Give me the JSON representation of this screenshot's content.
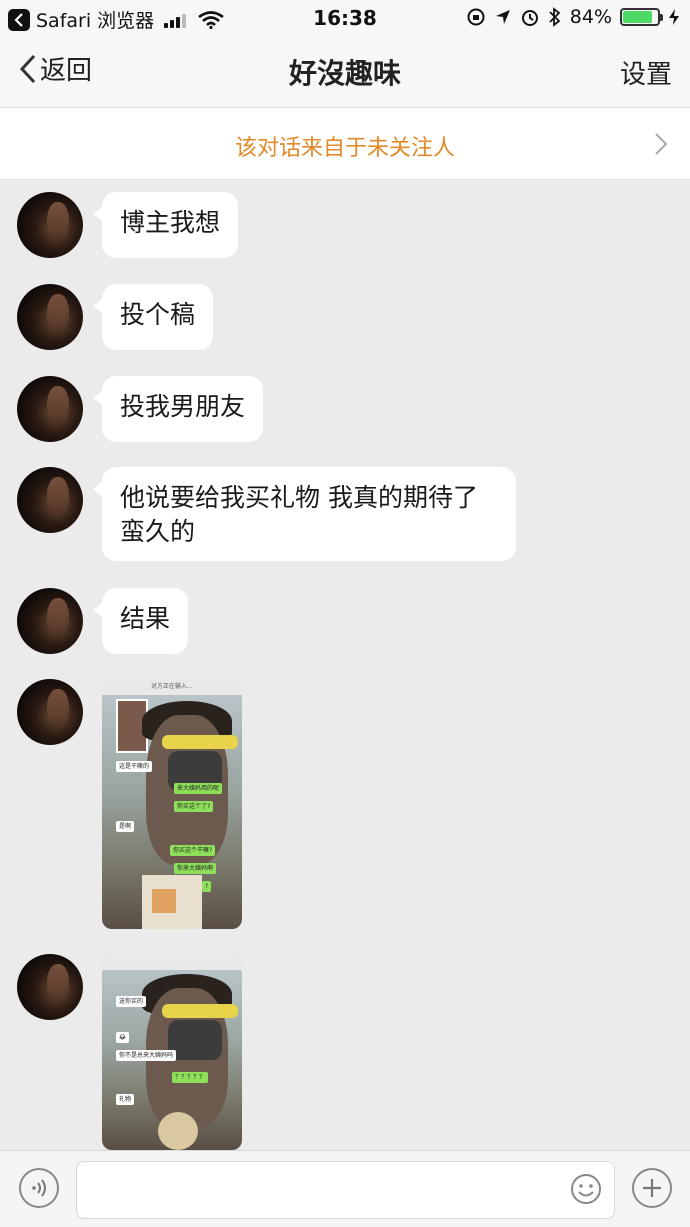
{
  "status_bar": {
    "back_app": "Safari 浏览器",
    "time": "16:38",
    "battery": "84%",
    "battery_level": 0.84,
    "signal_bars": 3
  },
  "nav": {
    "back_label": "返回",
    "title": "好沒趣味",
    "settings_label": "设置"
  },
  "notice": {
    "text": "该对话来自于未关注人"
  },
  "messages": [
    {
      "type": "text",
      "text": "博主我想"
    },
    {
      "type": "text",
      "text": "投个稿"
    },
    {
      "type": "text",
      "text": "投我男朋友"
    },
    {
      "type": "text",
      "text": "他说要给我买礼物 我真的期待了蛮久的"
    },
    {
      "type": "text",
      "text": "结果"
    },
    {
      "type": "image",
      "caption": "对方正在输入…"
    },
    {
      "type": "image",
      "caption": ""
    }
  ],
  "screenshot1": {
    "header": "对方正在输入…",
    "bubbles": [
      "这是干嘛的",
      "来大姨妈用的呢",
      "你买这个了?",
      "是啊",
      "你买这个干嘛?",
      "你来大姨妈啊",
      "?"
    ]
  },
  "screenshot2": {
    "bubbles": [
      "送你买的",
      "😂",
      "你不是总来大姨妈吗",
      "？？？？？",
      "礼物"
    ]
  },
  "input": {
    "placeholder": ""
  }
}
